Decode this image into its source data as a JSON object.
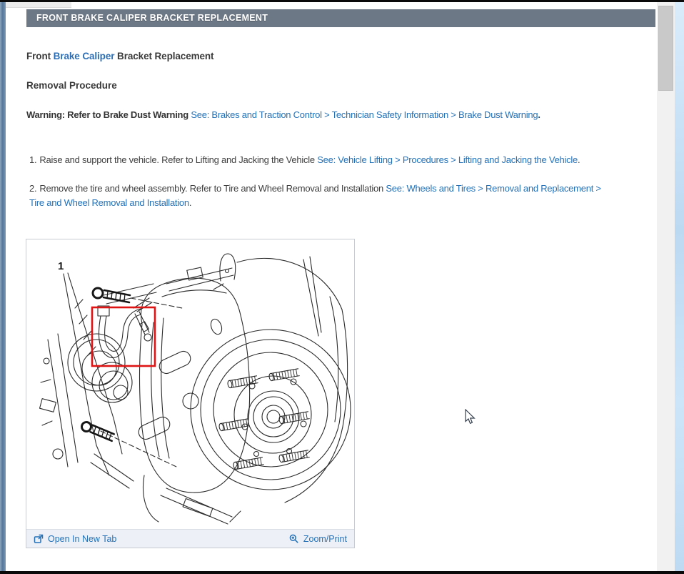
{
  "window": {
    "header_title": "FRONT BRAKE CALIPER BRACKET REPLACEMENT"
  },
  "doc": {
    "title": {
      "pre": "Front ",
      "link": "Brake Caliper",
      "post": " Bracket Replacement"
    },
    "section_heading": "Removal Procedure",
    "warning": {
      "bold": "Warning: Refer to Brake Dust Warning ",
      "link": "See: Brakes and Traction Control > Technician Safety Information > Brake Dust Warning",
      "suffix": "."
    },
    "steps": [
      {
        "num": "1.",
        "text": "Raise and support the vehicle. Refer to Lifting and Jacking the Vehicle ",
        "link": "See: Vehicle Lifting > Procedures > Lifting and Jacking the Vehicle",
        "suffix": "."
      },
      {
        "num": "2.",
        "text": "Remove the tire and wheel assembly. Refer to Tire and Wheel Removal and Installation ",
        "link": "See: Wheels and Tires > Removal and Replacement > Tire and Wheel Removal and Installation",
        "suffix": "."
      }
    ]
  },
  "figure": {
    "callout": "1",
    "description": "line drawing of front brake caliper, bracket and hub assembly with brake hose highlighted",
    "actions": {
      "open": "Open In New Tab",
      "zoom": "Zoom/Print"
    }
  },
  "colors": {
    "header_bg": "#6d7886",
    "link_blue": "#2471b8",
    "title_link_blue": "#2d6fb7",
    "body_text": "#3f3f3f",
    "highlight_red": "#de1414",
    "panel_footer_bg": "#edf1f7",
    "left_strip": "#54779c",
    "right_strip": "#bcd9f2",
    "scroll_thumb": "#c9c9c9"
  }
}
